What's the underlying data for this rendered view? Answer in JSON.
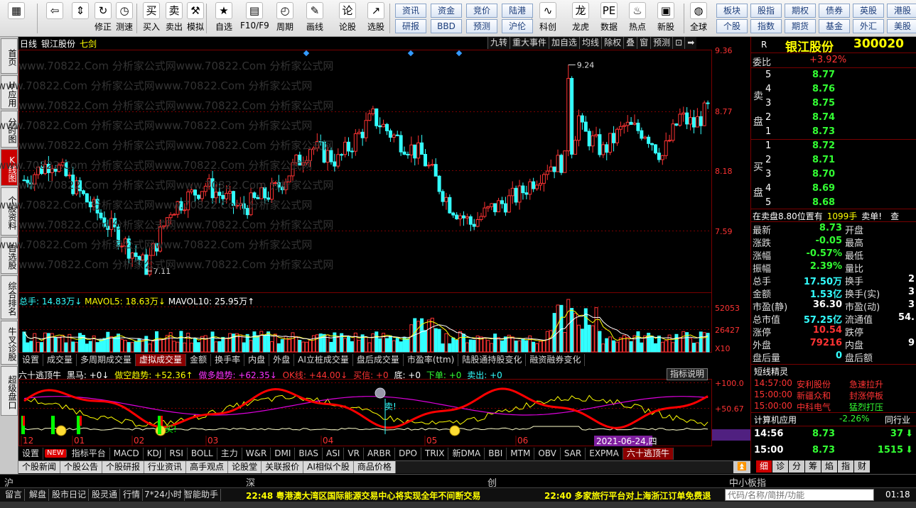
{
  "toolbar": {
    "buttons": [
      {
        "label": "",
        "icon": "app-logo-icon",
        "sym": "▦"
      },
      {
        "label": "",
        "icon": "back-arrow-icon",
        "sym": "⇦"
      },
      {
        "label": "",
        "icon": "up-down-arrows-icon",
        "sym": "⇕"
      },
      {
        "label": "修正",
        "icon": "refresh-icon",
        "sym": "↻"
      },
      {
        "label": "测速",
        "icon": "stopwatch-icon",
        "sym": "◷"
      },
      {
        "label": "买入",
        "icon": "buy-icon",
        "sym": "买"
      },
      {
        "label": "卖出",
        "icon": "sell-icon",
        "sym": "卖"
      },
      {
        "label": "模拟",
        "icon": "gavel-icon",
        "sym": "⚒"
      },
      {
        "label": "自选",
        "icon": "star-list-icon",
        "sym": "★"
      },
      {
        "label": "F10/F9",
        "icon": "document-icon",
        "sym": "▤"
      },
      {
        "label": "周期",
        "icon": "clock-icon",
        "sym": "◴"
      },
      {
        "label": "画线",
        "icon": "pencil-icon",
        "sym": "✎"
      },
      {
        "label": "论股",
        "icon": "discuss-icon",
        "sym": "论"
      },
      {
        "label": "选股",
        "icon": "chart-select-icon",
        "sym": "↗"
      },
      {
        "label": "科创",
        "icon": "sci-tech-icon",
        "sym": "∿"
      },
      {
        "label": "龙虎",
        "icon": "dragon-icon",
        "sym": "龙"
      },
      {
        "label": "数据",
        "icon": "pe-data-icon",
        "sym": "PE"
      },
      {
        "label": "热点",
        "icon": "fire-icon",
        "sym": "♨"
      },
      {
        "label": "新股",
        "icon": "new-stock-icon",
        "sym": "▣"
      },
      {
        "label": "全球",
        "icon": "globe-icon",
        "sym": "◍"
      }
    ],
    "chips_row1": [
      "资讯",
      "资金",
      "竞价",
      "陆港"
    ],
    "chips_row2": [
      "研报",
      "BBD",
      "预测",
      "沪伦"
    ],
    "chips_right_row1": [
      "板块",
      "股指",
      "期权",
      "债券",
      "英股",
      "港股"
    ],
    "chips_right_row2": [
      "个股",
      "指数",
      "期货",
      "基金",
      "外汇",
      "美股"
    ]
  },
  "left_tabs": [
    "首页",
    "H应用",
    "分时图",
    "K线图",
    "个股资料",
    "自选股",
    "综合排名",
    "牛叉诊股",
    "超级盘口"
  ],
  "active_left_tab": 3,
  "watermark": "www.70822.Com  分析家公式网www.70822.Com  分析家公式网",
  "kline_header": {
    "period": "日线",
    "stock": "银江股份",
    "name_tag": "七剑"
  },
  "kline_buttons": [
    "九转",
    "重大事件",
    "加自选",
    "均线",
    "除权",
    "叠",
    "窗",
    "预测",
    "⊡",
    "➡"
  ],
  "price_axis": [
    "9.36",
    "8.77",
    "8.18",
    "7.59"
  ],
  "annotations": {
    "high": "9.24",
    "low": "7.11"
  },
  "volume_header": {
    "total": "总手: 14.83万↓",
    "mavol5": "MAVOL5: 18.63万↓",
    "mavol10": "MAVOL10: 25.95万↑"
  },
  "volume_axis": [
    "52053",
    "26427",
    "X10"
  ],
  "vol_tabs": [
    "设置",
    "成交量",
    "多周期成交量",
    "虚拟成交量",
    "金额",
    "换手率",
    "内盘",
    "外盘",
    "AI立桩成交量",
    "盘后成交量",
    "市盈率(ttm)",
    "陆股通持股变化",
    "融资融券变化"
  ],
  "active_vol_tab": 3,
  "ind_header": {
    "name": "六十逃顶牛",
    "heima": "黑马: +0↓",
    "zuokong": "做空趋势: +52.36↑",
    "zuoduo": "做多趋势: +62.35↓",
    "ok": "OK线: +44.00↓",
    "maixin": "买信: +0",
    "di": "底: +0",
    "xiadan": "下单: +0",
    "maichu": "卖出: +0"
  },
  "ind_explain": "指标说明",
  "ind_axis": [
    "+100.0",
    "+50.67",
    "+0"
  ],
  "months": [
    "12",
    "01",
    "02",
    "03",
    "04",
    "05",
    "06"
  ],
  "date_tag": "2021-06-24,四",
  "ind_tabs": [
    "设置",
    "NEW",
    "指标平台",
    "MACD",
    "KDJ",
    "RSI",
    "BOLL",
    "主力",
    "W&R",
    "DMI",
    "BIAS",
    "ASI",
    "VR",
    "ARBR",
    "DPO",
    "TRIX",
    "新DMA",
    "BBI",
    "MTM",
    "OBV",
    "SAR",
    "EXPMA",
    "六十逃顶牛"
  ],
  "active_ind_tab": 22,
  "ind_marks": {
    "buy": "买!",
    "sell": "卖!"
  },
  "quote": {
    "flag": "R",
    "name": "银江股份",
    "code": "300020",
    "weibi_cap": "委比",
    "weibi": "+3.92%",
    "sell_side": "卖盘",
    "buy_side": "买盘",
    "sell": [
      {
        "n": "5",
        "p": "8.77"
      },
      {
        "n": "4",
        "p": "8.76"
      },
      {
        "n": "3",
        "p": "8.75"
      },
      {
        "n": "2",
        "p": "8.74"
      },
      {
        "n": "1",
        "p": "8.73"
      }
    ],
    "buy": [
      {
        "n": "1",
        "p": "8.72"
      },
      {
        "n": "2",
        "p": "8.71"
      },
      {
        "n": "3",
        "p": "8.70"
      },
      {
        "n": "4",
        "p": "8.69"
      },
      {
        "n": "5",
        "p": "8.68"
      }
    ],
    "order_line": {
      "a": "在卖盘8.80位置有",
      "b": "1099手",
      "c": "卖单!",
      "d": "查"
    },
    "stats": [
      {
        "c1": "最新",
        "v1": "8.73",
        "k1": "green",
        "c2": "开盘",
        "v2": ""
      },
      {
        "c1": "涨跌",
        "v1": "-0.05",
        "k1": "green",
        "c2": "最高",
        "v2": ""
      },
      {
        "c1": "涨幅",
        "v1": "-0.57%",
        "k1": "green",
        "c2": "最低",
        "v2": ""
      },
      {
        "c1": "振幅",
        "v1": "2.39%",
        "k1": "green",
        "c2": "量比",
        "v2": ""
      },
      {
        "c1": "总手",
        "v1": "17.50万",
        "k1": "cyan",
        "c2": "换手",
        "v2": "2"
      },
      {
        "c1": "金额",
        "v1": "1.53亿",
        "k1": "cyan",
        "c2": "换手(实)",
        "v2": "3"
      },
      {
        "c1": "市盈(静)",
        "v1": "36.30",
        "k1": "white",
        "c2": "市盈(动)",
        "v2": "3"
      },
      {
        "c1": "总市值",
        "v1": "57.25亿",
        "k1": "cyan",
        "c2": "流通值",
        "v2": "54."
      },
      {
        "c1": "涨停",
        "v1": "10.54",
        "k1": "red",
        "c2": "跌停",
        "v2": ""
      },
      {
        "c1": "外盘",
        "v1": "79216",
        "k1": "red",
        "c2": "内盘",
        "v2": "9"
      },
      {
        "c1": "盘后量",
        "v1": "0",
        "k1": "cyan",
        "c2": "盘后额",
        "v2": ""
      }
    ],
    "elves_title": "短线精灵",
    "elves": [
      {
        "t": "14:57:00",
        "n": "安利股份",
        "e": "急速拉升",
        "k": "red"
      },
      {
        "t": "15:00:00",
        "n": "新疆众和",
        "e": "封涨停板",
        "k": "red"
      },
      {
        "t": "15:00:00",
        "n": "中科电气",
        "e": "猛烈打压",
        "k": "green"
      }
    ],
    "sector": {
      "name": "计算机应用",
      "chg": "-2.26%",
      "more": "同行业"
    },
    "ticks": [
      {
        "t": "14:56",
        "p": "8.73",
        "v": "37"
      },
      {
        "t": "15:00",
        "p": "8.73",
        "v": "1515"
      }
    ]
  },
  "news_tabs": [
    "个股新闻",
    "个股公告",
    "个股研报",
    "行业资讯",
    "高手观点",
    "论股堂",
    "关联报价",
    "AI相似个股",
    "商品价格"
  ],
  "right_tabs": [
    "细",
    "诊",
    "分",
    "筹",
    "焰",
    "指",
    "财"
  ],
  "active_right_tab": 0,
  "index_bar": {
    "sh": "沪",
    "sz": "深",
    "cy": "创",
    "zx": "中小板指"
  },
  "status": {
    "buttons": [
      "留言",
      "解盘",
      "股市日记",
      "股灵通",
      "行情",
      "7*24小时",
      "智能助手"
    ],
    "news1": "22:48 粤港澳大湾区国际能源交易中心将实现全年不间断交易",
    "news2": "22:40 多家旅行平台对上海浙江订单免费退",
    "search_placeholder": "代码/名称/简拼/功能",
    "time": "01:18"
  },
  "colors": {
    "up": "#ff3333",
    "down": "#33ffff",
    "bg": "#000000",
    "grid": "#7a0000"
  }
}
